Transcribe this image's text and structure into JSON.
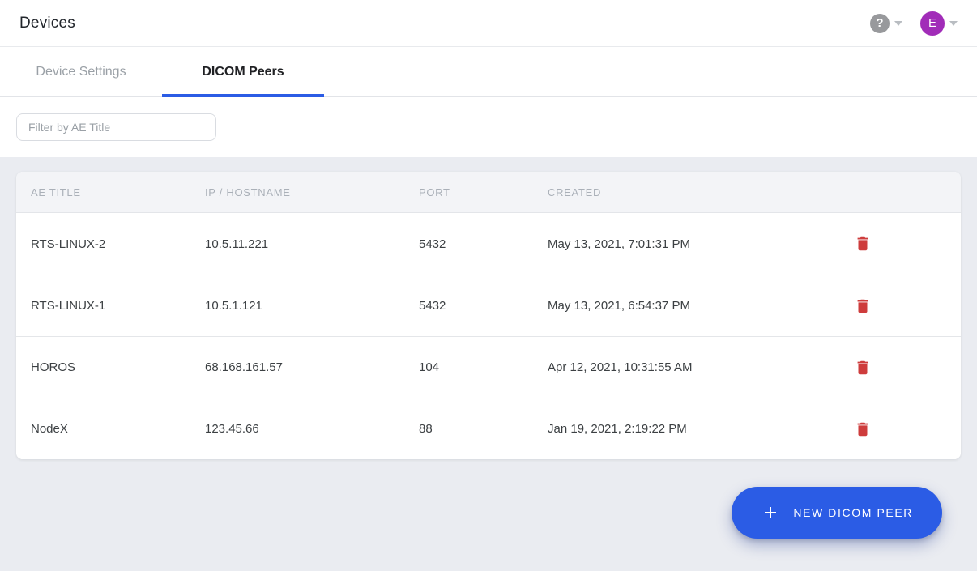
{
  "header": {
    "title": "Devices",
    "help_glyph": "?",
    "avatar_initial": "E"
  },
  "tabs": [
    {
      "label": "Device Settings",
      "active": false
    },
    {
      "label": "DICOM Peers",
      "active": true
    }
  ],
  "filter": {
    "placeholder": "Filter by AE Title"
  },
  "table": {
    "columns": [
      "AE TITLE",
      "IP / HOSTNAME",
      "PORT",
      "CREATED"
    ],
    "rows": [
      {
        "ae_title": "RTS-LINUX-2",
        "ip": "10.5.11.221",
        "port": "5432",
        "created": "May 13, 2021, 7:01:31 PM"
      },
      {
        "ae_title": "RTS-LINUX-1",
        "ip": "10.5.1.121",
        "port": "5432",
        "created": "May 13, 2021, 6:54:37 PM"
      },
      {
        "ae_title": "HOROS",
        "ip": "68.168.161.57",
        "port": "104",
        "created": "Apr 12, 2021, 10:31:55 AM"
      },
      {
        "ae_title": "NodeX",
        "ip": "123.45.66",
        "port": "88",
        "created": "Jan 19, 2021, 2:19:22 PM"
      }
    ]
  },
  "fab": {
    "label": "NEW DICOM PEER"
  },
  "colors": {
    "accent_blue": "#2b5ce5",
    "danger_red": "#ce3c3c",
    "avatar_purple": "#a12cb8",
    "help_gray": "#98999c"
  }
}
